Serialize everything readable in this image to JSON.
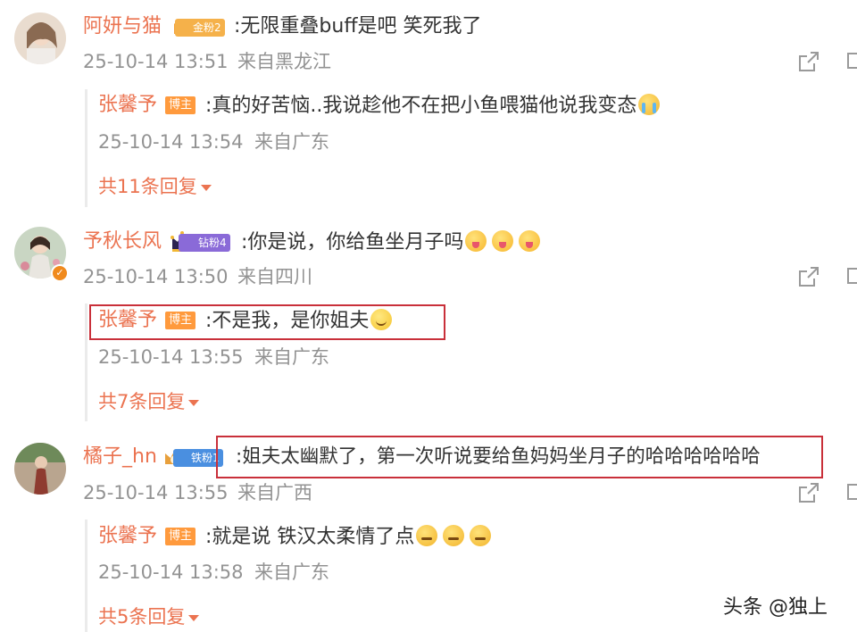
{
  "comments": [
    {
      "user": "阿妍与猫",
      "fan_badge": "金粉2",
      "text": ":无限重叠buff是吧 笑死我了",
      "time": "25-10-14 13:51",
      "location": "来自黑龙江",
      "reply": {
        "user": "张馨予",
        "host_badge": "博主",
        "text": ":真的好苦恼..我说趁他不在把小鱼喂猫他说我变态",
        "time": "25-10-14 13:54",
        "location": "来自广东",
        "emojis": [
          "crying-face"
        ]
      },
      "more_replies": "共11条回复"
    },
    {
      "user": "予秋长风",
      "fan_badge": "钻粉4",
      "text": ":你是说，你给鱼坐月子吗",
      "time": "25-10-14 13:50",
      "location": "来自四川",
      "emojis": [
        "tongue-face",
        "tongue-face",
        "tongue-face"
      ],
      "reply": {
        "user": "张馨予",
        "host_badge": "博主",
        "text": ":不是我，是你姐夫",
        "time": "25-10-14 13:55",
        "location": "来自广东",
        "emojis": [
          "smile-face"
        ]
      },
      "more_replies": "共7条回复"
    },
    {
      "user": "橘子_hn",
      "fan_badge": "铁粉1",
      "text": ":姐夫太幽默了，第一次听说要给鱼妈妈坐月子的哈哈哈哈哈哈",
      "time": "25-10-14 13:55",
      "location": "来自广西",
      "reply": {
        "user": "张馨予",
        "host_badge": "博主",
        "text": ":就是说 铁汉太柔情了点",
        "time": "25-10-14 13:58",
        "location": "来自广东",
        "emojis": [
          "sly-face",
          "sly-face",
          "sly-face"
        ]
      },
      "more_replies": "共5条回复"
    }
  ],
  "watermark": "头条 @独上",
  "colors": {
    "username": "#eb7350",
    "meta": "#939393",
    "highlight_box": "#c9303a",
    "host_badge": "#ff9a3d"
  }
}
